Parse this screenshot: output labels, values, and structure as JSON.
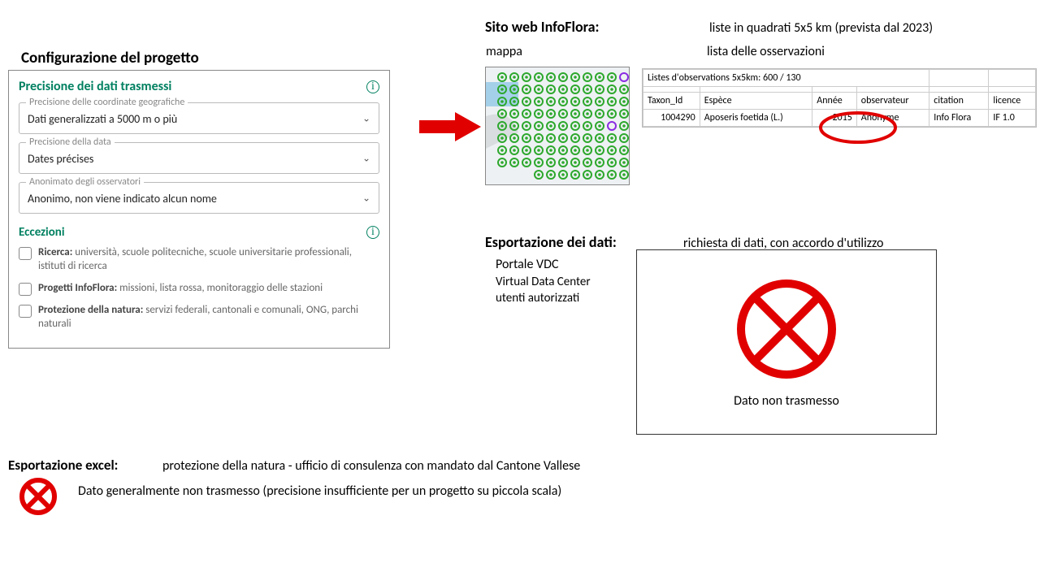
{
  "config": {
    "title": "Configurazione del progetto",
    "precision_header": "Precisione dei dati trasmessi",
    "fields": [
      {
        "label": "Precisione delle coordinate geografiche",
        "value": "Dati generalizzati a 5000 m o più"
      },
      {
        "label": "Precisione della data",
        "value": "Dates précises"
      },
      {
        "label": "Anonimato degli osservatori",
        "value": "Anonimo, non viene indicato alcun nome"
      }
    ],
    "eccezioni_header": "Eccezioni",
    "eccezioni": [
      {
        "b": "Ricerca:",
        "t": " università, scuole politecniche, scuole universitarie professionali, istituti di ricerca"
      },
      {
        "b": "Progetti InfoFlora:",
        "t": " missioni, lista rossa, monitoraggio delle stazioni"
      },
      {
        "b": "Protezione della natura:",
        "t": " servizi federali, cantonali e comunali, ONG, parchi naturali"
      }
    ]
  },
  "sito": {
    "label": "Sito web InfoFlora:",
    "value": "liste in quadrati 5x5 km (prevista dal 2023)",
    "mappa": "mappa",
    "lista": "lista delle osservazioni"
  },
  "table": {
    "caption": "Listes d'observations 5x5km:  600 / 130",
    "headers": [
      "Taxon_Id",
      "Espèce",
      "Année",
      "observateur",
      "citation",
      "licence"
    ],
    "row": [
      "1004290",
      "Aposeris foetida (L.)",
      "2015",
      "Anonyme",
      "Info Flora",
      "IF 1.0"
    ]
  },
  "export": {
    "label": "Esportazione dei dati:",
    "value": "richiesta di dati, con accordo d'utilizzo",
    "vdc1": "Portale VDC",
    "vdc2": "Virtual Data Center",
    "vdc3": "utenti autorizzati",
    "box_caption": "Dato non trasmesso"
  },
  "excel": {
    "label": "Esportazione excel:",
    "value": "protezione della natura - ufficio di consulenza con mandato dal Cantone Vallese",
    "text": "Dato generalmente non trasmesso (precisione insufficiente per un progetto su piccola scala)"
  }
}
